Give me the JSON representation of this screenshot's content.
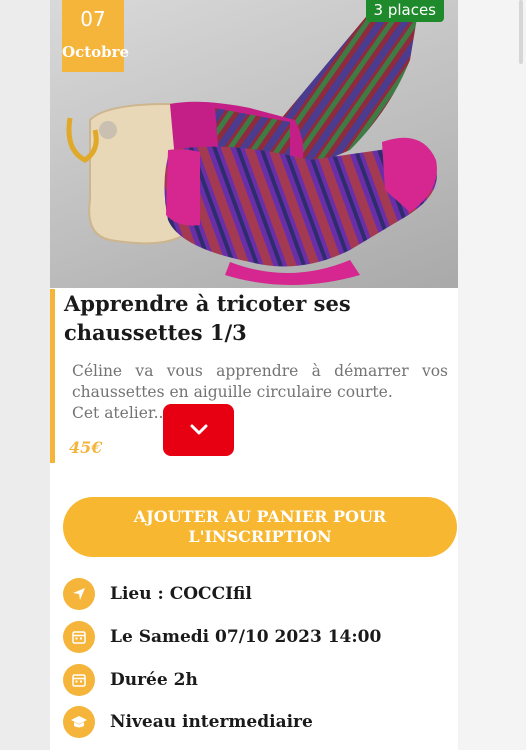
{
  "event": {
    "date_day": "07",
    "date_month": "Octobre",
    "places": "3 places",
    "title": "Apprendre à tricoter ses chaussettes 1/3",
    "description_line1": "Céline va vous apprendre à démarrer vos chaussettes en aiguille circulaire courte.",
    "description_line2": "Cet atelier...",
    "price": "45€"
  },
  "actions": {
    "add_to_cart_label": "AJOUTER AU PANIER POUR L'INSCRIPTION"
  },
  "details": [
    {
      "icon": "location-arrow-icon",
      "text": "Lieu : COCCIfil"
    },
    {
      "icon": "calendar-icon",
      "text": "Le Samedi 07/10 2023 14:00"
    },
    {
      "icon": "calendar-icon",
      "text": "Durée 2h"
    },
    {
      "icon": "graduation-cap-icon",
      "text": "Niveau intermediaire"
    }
  ],
  "colors": {
    "accent": "#f5b43a",
    "places_badge": "#1f8a2c",
    "expand_button": "#e60012"
  }
}
